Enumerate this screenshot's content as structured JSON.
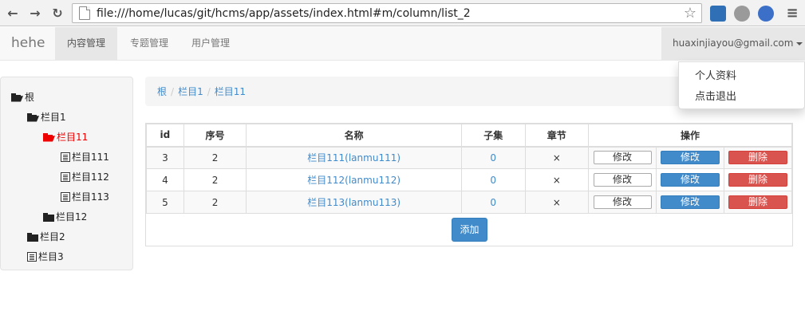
{
  "browser": {
    "url": "file:///home/lucas/git/hcms/app/assets/index.html#m/column/list_2"
  },
  "navbar": {
    "brand": "hehe",
    "items": [
      {
        "label": "内容管理",
        "active": true
      },
      {
        "label": "专题管理",
        "active": false
      },
      {
        "label": "用户管理",
        "active": false
      }
    ],
    "user": "huaxinjiayou@gmail.com",
    "dropdown": [
      "个人资料",
      "点击退出"
    ]
  },
  "tree": [
    {
      "label": "根",
      "icon": "folder-open-icon",
      "level": 0
    },
    {
      "label": "栏目1",
      "icon": "folder-open-icon",
      "level": 1
    },
    {
      "label": "栏目11",
      "icon": "folder-open-icon",
      "level": 2,
      "selected": true
    },
    {
      "label": "栏目111",
      "icon": "list-icon",
      "level": 3
    },
    {
      "label": "栏目112",
      "icon": "list-icon",
      "level": 3
    },
    {
      "label": "栏目113",
      "icon": "list-icon",
      "level": 3
    },
    {
      "label": "栏目12",
      "icon": "folder-icon",
      "level": 2
    },
    {
      "label": "栏目2",
      "icon": "folder-icon",
      "level": 1
    },
    {
      "label": "栏目3",
      "icon": "list-icon",
      "level": 1
    }
  ],
  "breadcrumb": [
    "根",
    "栏目1",
    "栏目11"
  ],
  "table": {
    "headers": [
      "id",
      "序号",
      "名称",
      "子集",
      "章节",
      "操作"
    ],
    "rows": [
      {
        "id": "3",
        "order": "2",
        "name": "栏目111(lanmu111)",
        "children": "0",
        "chapter": "×"
      },
      {
        "id": "4",
        "order": "2",
        "name": "栏目112(lanmu112)",
        "children": "0",
        "chapter": "×"
      },
      {
        "id": "5",
        "order": "2",
        "name": "栏目113(lanmu113)",
        "children": "0",
        "chapter": "×"
      }
    ],
    "actions": {
      "edit1": "修改",
      "edit2": "修改",
      "delete": "删除"
    },
    "add_label": "添加"
  },
  "colors": {
    "link": "#428bca",
    "danger": "#d9534f",
    "selected": "#ee0000"
  }
}
